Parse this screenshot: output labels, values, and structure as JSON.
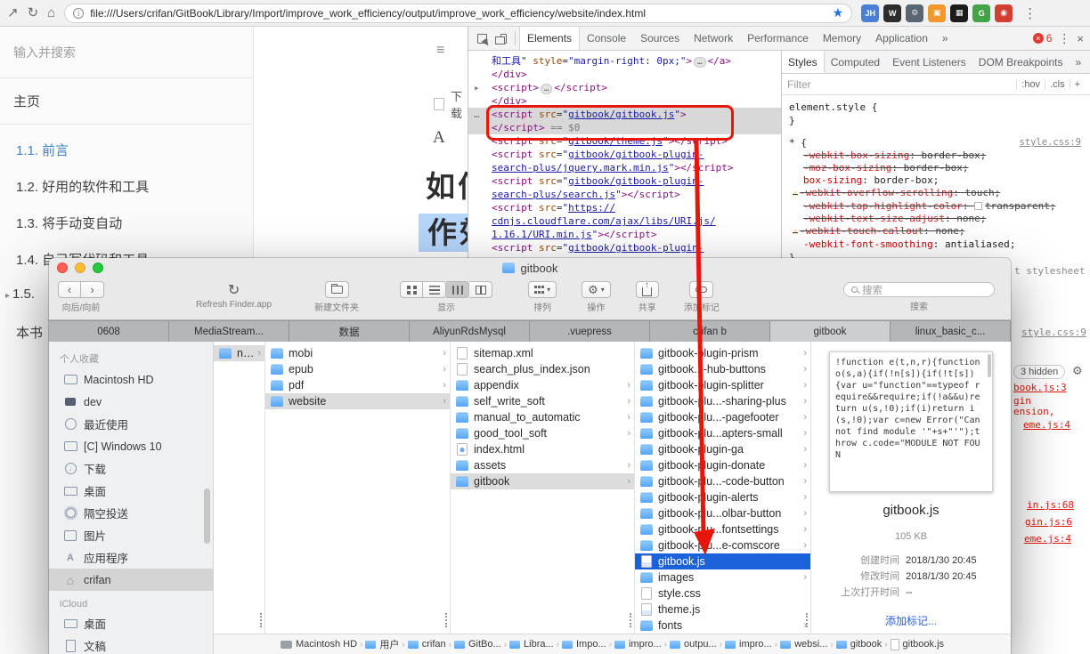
{
  "colors": {
    "annotation_red": "#e8150b",
    "selection_blue": "#1a62d8",
    "gitbook_link_blue": "#4183c4",
    "bookmark_star_blue": "#1a73e8"
  },
  "browser": {
    "url": "file:///Users/crifan/GitBook/Library/Import/improve_work_efficiency/output/improve_work_efficiency/website/index.html",
    "extensions": [
      {
        "name": "jh-extension",
        "label": "JH",
        "bg": "#4a7fd4",
        "fg": "#ffffff"
      },
      {
        "name": "wiki-extension",
        "label": "W",
        "bg": "#2d2d2d",
        "fg": "#ffffff"
      },
      {
        "name": "gear-extension",
        "label": "⚙",
        "bg": "#5b6770",
        "fg": "#e8e8e8"
      },
      {
        "name": "orange-extension",
        "label": "▣",
        "bg": "#f0982d",
        "fg": "#ffffff"
      },
      {
        "name": "qr-extension",
        "label": "▦",
        "bg": "#1c1c1c",
        "fg": "#ffffff"
      },
      {
        "name": "grs-extension",
        "label": "G",
        "bg": "#44a248",
        "fg": "#ffffff"
      },
      {
        "name": "red-extension",
        "label": "◉",
        "bg": "#d23f31",
        "fg": "#ffffff"
      }
    ]
  },
  "gitbook": {
    "search_placeholder": "输入并搜索",
    "nav_home": "主页",
    "nav_items": [
      {
        "label": "1.1. 前言",
        "active": true
      },
      {
        "label": "1.2. 好用的软件和工具"
      },
      {
        "label": "1.3. 将手动变自动"
      },
      {
        "label": "1.4. 自己写代码和工具"
      },
      {
        "label": "1.5.",
        "expand": true
      },
      {
        "label": "本书",
        "spaced": true
      }
    ],
    "hamburger": "≡",
    "download_label": "下载",
    "fontsettings_label": "A",
    "title_line1": "如何",
    "title_line2": "作效"
  },
  "devtools": {
    "tabs": [
      {
        "label": "Elements",
        "selected": true
      },
      {
        "label": "Console"
      },
      {
        "label": "Sources"
      },
      {
        "label": "Network"
      },
      {
        "label": "Performance"
      },
      {
        "label": "Memory"
      },
      {
        "label": "Application"
      },
      {
        "label": "»"
      }
    ],
    "error_count": "6",
    "dom_lines": [
      {
        "parts": [
          [
            "val",
            "和工具\" "
          ],
          [
            "attr",
            "style"
          ],
          [
            "plain",
            "="
          ],
          [
            "val",
            "\"margin-right: 0px;\""
          ],
          [
            "tag",
            ">"
          ],
          [
            "pill",
            "…"
          ],
          [
            "tag",
            "</a>"
          ]
        ]
      },
      {
        "parts": [
          [
            "tag",
            "</div>"
          ]
        ]
      },
      {
        "gutter": "▸",
        "parts": [
          [
            "tag",
            "<script>"
          ],
          [
            "pill",
            "…"
          ],
          [
            "tag",
            "</script>"
          ]
        ]
      },
      {
        "parts": [
          [
            "tag",
            "</div>"
          ]
        ]
      },
      {
        "hl": true,
        "gutter": "…",
        "parts": [
          [
            "tag",
            "<script "
          ],
          [
            "attr",
            "src"
          ],
          [
            "plain",
            "="
          ],
          [
            "val",
            "\""
          ],
          [
            "link",
            "gitbook/gitbook.js"
          ],
          [
            "val",
            "\""
          ],
          [
            "tag",
            ">"
          ]
        ]
      },
      {
        "hl": true,
        "parts": [
          [
            "tag",
            "</script>"
          ],
          [
            "eq",
            " == $0"
          ]
        ]
      },
      {
        "parts": [
          [
            "tag",
            "<script "
          ],
          [
            "attr",
            "src"
          ],
          [
            "plain",
            "="
          ],
          [
            "val",
            "\""
          ],
          [
            "link",
            "gitbook/theme.js"
          ],
          [
            "val",
            "\""
          ],
          [
            "tag",
            ">"
          ],
          [
            "tag",
            "</script>"
          ]
        ]
      },
      {
        "parts": [
          [
            "tag",
            "<script "
          ],
          [
            "attr",
            "src"
          ],
          [
            "plain",
            "="
          ],
          [
            "val",
            "\""
          ],
          [
            "link",
            "gitbook/gitbook-plugin-"
          ]
        ]
      },
      {
        "parts": [
          [
            "link",
            "search-plus/jquery.mark.min.js"
          ],
          [
            "val",
            "\""
          ],
          [
            "tag",
            ">"
          ],
          [
            "tag",
            "</script>"
          ]
        ]
      },
      {
        "parts": [
          [
            "tag",
            "<script "
          ],
          [
            "attr",
            "src"
          ],
          [
            "plain",
            "="
          ],
          [
            "val",
            "\""
          ],
          [
            "link",
            "gitbook/gitbook-plugin-"
          ]
        ]
      },
      {
        "parts": [
          [
            "link",
            "search-plus/search.js"
          ],
          [
            "val",
            "\""
          ],
          [
            "tag",
            ">"
          ],
          [
            "tag",
            "</script>"
          ]
        ]
      },
      {
        "parts": [
          [
            "tag",
            "<script "
          ],
          [
            "attr",
            "src"
          ],
          [
            "plain",
            "="
          ],
          [
            "val",
            "\""
          ],
          [
            "link",
            "https://"
          ]
        ]
      },
      {
        "parts": [
          [
            "link",
            "cdnjs.cloudflare.com/ajax/libs/URI.js/"
          ]
        ]
      },
      {
        "parts": [
          [
            "link",
            "1.16.1/URI.min.js"
          ],
          [
            "val",
            "\""
          ],
          [
            "tag",
            ">"
          ],
          [
            "tag",
            "</script>"
          ]
        ]
      },
      {
        "parts": [
          [
            "tag",
            "<script "
          ],
          [
            "attr",
            "src"
          ],
          [
            "plain",
            "="
          ],
          [
            "val",
            "\""
          ],
          [
            "link",
            "gitbook/gitbook-plugin-"
          ]
        ]
      }
    ],
    "styles": {
      "tabs": [
        {
          "label": "Styles",
          "selected": true
        },
        {
          "label": "Computed"
        },
        {
          "label": "Event Listeners"
        },
        {
          "label": "DOM Breakpoints"
        },
        {
          "label": "»"
        }
      ],
      "filter_placeholder": "Filter",
      "pseudo_btn": ":hov",
      "class_btn": ".cls",
      "add_btn": "+",
      "inline_selector": "element.style",
      "rule_selector": "*",
      "rule_source": "style.css:9",
      "props": [
        {
          "name": "-webkit-box-sizing",
          "value": "border-box",
          "struck": true
        },
        {
          "name": "-moz-box-sizing",
          "value": "border-box",
          "struck": true
        },
        {
          "name": "box-sizing",
          "value": "border-box"
        },
        {
          "name": "-webkit-overflow-scrolling",
          "value": "touch",
          "struck": true,
          "warn": true
        },
        {
          "name": "-webkit-tap-highlight-color",
          "value": "transparent",
          "struck": true,
          "swatch": true
        },
        {
          "name": "-webkit-text-size-adjust",
          "value": "none",
          "struck": true
        },
        {
          "name": "-webkit-touch-callout",
          "value": "none",
          "struck": true,
          "warn": true
        },
        {
          "name": "-webkit-font-smoothing",
          "value": "antialiased"
        }
      ]
    },
    "fragments": {
      "agent_stylesheet": "t stylesheet",
      "style_source": "style.css:9",
      "hidden_badge": "3 hidden",
      "gear": "⚙",
      "err1": "book.js:3",
      "err2": "gin",
      "err3": "ension,",
      "err4": "eme.js:4",
      "err5": "in.js:68",
      "err6": "gin.js:6",
      "err7": "eme.js:4"
    }
  },
  "finder": {
    "title": "gitbook",
    "toolbar": {
      "back_glyph": "‹",
      "forward_glyph": "›",
      "back_label": "向后/向前",
      "refresh_glyph": "↻",
      "refresh_label": "Refresh Finder.app",
      "newfolder_label": "新建文件夹",
      "view_label": "显示",
      "sort_label": "排列",
      "action_glyph": "⚙",
      "action_label": "操作",
      "share_label": "共享",
      "tag_label": "添加标记",
      "search_placeholder": "搜索",
      "search_label": "搜索"
    },
    "tabs": [
      {
        "label": "0608"
      },
      {
        "label": "MediaStream..."
      },
      {
        "label": "数据"
      },
      {
        "label": "AliyunRdsMysql"
      },
      {
        "label": ".vuepress"
      },
      {
        "label": "crifan b"
      },
      {
        "label": "gitbook",
        "active": true
      },
      {
        "label": "linux_basic_c..."
      }
    ],
    "plus_tab": "+",
    "sidebar": {
      "fav_header": "个人收藏",
      "fav_items": [
        {
          "label": "Macintosh HD",
          "icon": "drive"
        },
        {
          "label": "dev",
          "icon": "dev"
        },
        {
          "label": "最近使用",
          "icon": "clock"
        },
        {
          "label": "[C] Windows 10",
          "icon": "drive"
        },
        {
          "label": "下载",
          "icon": "download"
        },
        {
          "label": "桌面",
          "icon": "desktop"
        },
        {
          "label": "隔空投送",
          "icon": "airdrop"
        },
        {
          "label": "图片",
          "icon": "photos"
        },
        {
          "label": "应用程序",
          "icon": "apps"
        },
        {
          "label": "crifan",
          "icon": "home",
          "selected": true
        }
      ],
      "icloud_header": "iCloud",
      "icloud_items": [
        {
          "label": "桌面",
          "icon": "desktop"
        },
        {
          "label": "文稿",
          "icon": "docs"
        }
      ]
    },
    "columns0": [
      {
        "label": "ncy",
        "type": "folder",
        "chevron": true,
        "selected": "gray"
      }
    ],
    "columns1": [
      {
        "label": "mobi",
        "type": "folder",
        "chevron": true
      },
      {
        "label": "epub",
        "type": "folder",
        "chevron": true
      },
      {
        "label": "pdf",
        "type": "folder",
        "chevron": true
      },
      {
        "label": "website",
        "type": "folder",
        "chevron": true,
        "selected": "gray"
      }
    ],
    "columns2": [
      {
        "label": "sitemap.xml",
        "type": "file"
      },
      {
        "label": "search_plus_index.json",
        "type": "file"
      },
      {
        "label": "appendix",
        "type": "folder",
        "chevron": true
      },
      {
        "label": "self_write_soft",
        "type": "folder",
        "chevron": true
      },
      {
        "label": "manual_to_automatic",
        "type": "folder",
        "chevron": true
      },
      {
        "label": "good_tool_soft",
        "type": "folder",
        "chevron": true
      },
      {
        "label": "index.html",
        "type": "file-html"
      },
      {
        "label": "assets",
        "type": "folder",
        "chevron": true
      },
      {
        "label": "gitbook",
        "type": "folder",
        "chevron": true,
        "selected": "gray"
      }
    ],
    "columns3": [
      {
        "label": "gitbook-plugin-prism",
        "type": "folder",
        "chevron": true
      },
      {
        "label": "gitbook...-hub-buttons",
        "type": "folder",
        "chevron": true
      },
      {
        "label": "gitbook-plugin-splitter",
        "type": "folder",
        "chevron": true
      },
      {
        "label": "gitbook-plu...-sharing-plus",
        "type": "folder",
        "chevron": true
      },
      {
        "label": "gitbook-plu...-pagefooter",
        "type": "folder",
        "chevron": true
      },
      {
        "label": "gitbook-plu...apters-small",
        "type": "folder",
        "chevron": true
      },
      {
        "label": "gitbook-plugin-ga",
        "type": "folder",
        "chevron": true
      },
      {
        "label": "gitbook-plugin-donate",
        "type": "folder",
        "chevron": true
      },
      {
        "label": "gitbook-plu...-code-button",
        "type": "folder",
        "chevron": true
      },
      {
        "label": "gitbook-plugin-alerts",
        "type": "folder",
        "chevron": true
      },
      {
        "label": "gitbook-plu...olbar-button",
        "type": "folder",
        "chevron": true
      },
      {
        "label": "gitbook-plu...fontsettings",
        "type": "folder",
        "chevron": true
      },
      {
        "label": "gitbook-plu...e-comscore",
        "type": "folder",
        "chevron": true
      },
      {
        "label": "gitbook.js",
        "type": "file-js",
        "selected": "blue"
      },
      {
        "label": "images",
        "type": "folder",
        "chevron": true
      },
      {
        "label": "style.css",
        "type": "file"
      },
      {
        "label": "theme.js",
        "type": "file-js"
      },
      {
        "label": "fonts",
        "type": "folder",
        "chevron": true
      }
    ],
    "preview": {
      "code": "!function e(t,n,r){function o(s,a){if(!n[s]){if(!t[s]){var u=\"function\"==typeof require&&require;if(!a&&u)return u(s,!0);if(i)return i(s,!0);var c=new Error(\"Cannot find module '\"+s+\"'\");throw c.code=\"MODULE NOT FOUN",
      "filename": "gitbook.js",
      "filesize": "105 KB",
      "meta": [
        {
          "label": "创建时间",
          "value": "2018/1/30 20:45"
        },
        {
          "label": "修改时间",
          "value": "2018/1/30 20:45"
        },
        {
          "label": "上次打开时间",
          "value": "--"
        }
      ],
      "add_tags": "添加标记..."
    },
    "pathbar": [
      {
        "label": "Macintosh HD",
        "icon": "disk"
      },
      {
        "label": "用户",
        "icon": "folder"
      },
      {
        "label": "crifan",
        "icon": "home"
      },
      {
        "label": "GitBo...",
        "icon": "folder"
      },
      {
        "label": "Libra...",
        "icon": "folder"
      },
      {
        "label": "Impo...",
        "icon": "folder"
      },
      {
        "label": "impro...",
        "icon": "folder"
      },
      {
        "label": "outpu...",
        "icon": "folder"
      },
      {
        "label": "impro...",
        "icon": "folder"
      },
      {
        "label": "websi...",
        "icon": "folder"
      },
      {
        "label": "gitbook",
        "icon": "folder"
      },
      {
        "label": "gitbook.js",
        "icon": "file"
      }
    ]
  }
}
